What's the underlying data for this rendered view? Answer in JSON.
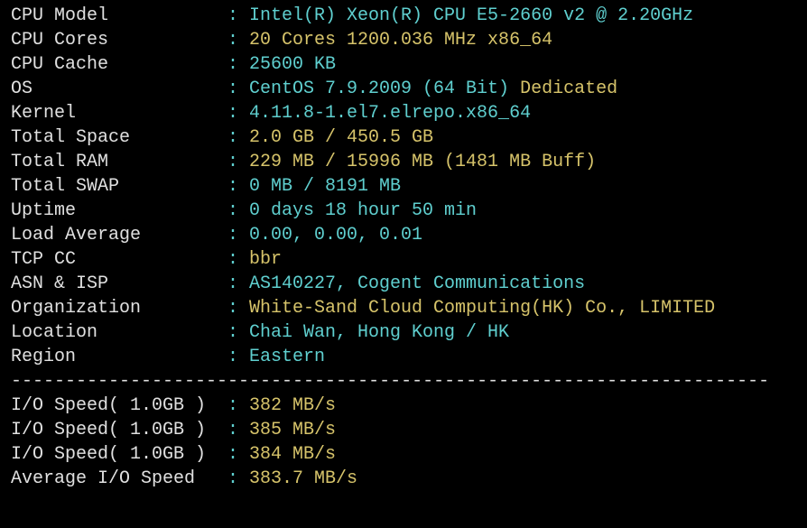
{
  "rows": [
    {
      "label": "CPU Model",
      "segments": [
        {
          "text": "Intel(R) Xeon(R) CPU E5-2660 v2 @ 2.20GHz",
          "color": "cyan"
        }
      ]
    },
    {
      "label": "CPU Cores",
      "segments": [
        {
          "text": "20 Cores 1200.036 MHz x86_64",
          "color": "yellow"
        }
      ]
    },
    {
      "label": "CPU Cache",
      "segments": [
        {
          "text": "25600 KB",
          "color": "cyan"
        }
      ]
    },
    {
      "label": "OS",
      "segments": [
        {
          "text": "CentOS 7.9.2009 (64 Bit)",
          "color": "cyan"
        },
        {
          "text": " Dedicated",
          "color": "yellow"
        }
      ]
    },
    {
      "label": "Kernel",
      "segments": [
        {
          "text": "4.11.8-1.el7.elrepo.x86_64",
          "color": "cyan"
        }
      ]
    },
    {
      "label": "Total Space",
      "segments": [
        {
          "text": "2.0 GB / 450.5 GB",
          "color": "yellow"
        }
      ]
    },
    {
      "label": "Total RAM",
      "segments": [
        {
          "text": "229 MB / 15996 MB (1481 MB Buff)",
          "color": "yellow"
        }
      ]
    },
    {
      "label": "Total SWAP",
      "segments": [
        {
          "text": "0 MB / 8191 MB",
          "color": "cyan"
        }
      ]
    },
    {
      "label": "Uptime",
      "segments": [
        {
          "text": "0 days 18 hour 50 min",
          "color": "cyan"
        }
      ]
    },
    {
      "label": "Load Average",
      "segments": [
        {
          "text": "0.00, 0.00, 0.01",
          "color": "cyan"
        }
      ]
    },
    {
      "label": "TCP CC",
      "segments": [
        {
          "text": "bbr",
          "color": "yellow"
        }
      ]
    },
    {
      "label": "ASN & ISP",
      "segments": [
        {
          "text": "AS140227, Cogent Communications",
          "color": "cyan"
        }
      ]
    },
    {
      "label": "Organization",
      "segments": [
        {
          "text": "White-Sand Cloud Computing(HK) Co., LIMITED",
          "color": "yellow"
        }
      ]
    },
    {
      "label": "Location",
      "segments": [
        {
          "text": "Chai Wan, Hong Kong / HK",
          "color": "cyan"
        }
      ]
    },
    {
      "label": "Region",
      "segments": [
        {
          "text": "Eastern",
          "color": "cyan"
        }
      ]
    }
  ],
  "divider": "----------------------------------------------------------------------",
  "io_rows": [
    {
      "label": "I/O Speed( 1.0GB )",
      "value": "382 MB/s"
    },
    {
      "label": "I/O Speed( 1.0GB )",
      "value": "385 MB/s"
    },
    {
      "label": "I/O Speed( 1.0GB )",
      "value": "384 MB/s"
    },
    {
      "label": "Average I/O Speed",
      "value": "383.7 MB/s"
    }
  ],
  "colon": ": "
}
